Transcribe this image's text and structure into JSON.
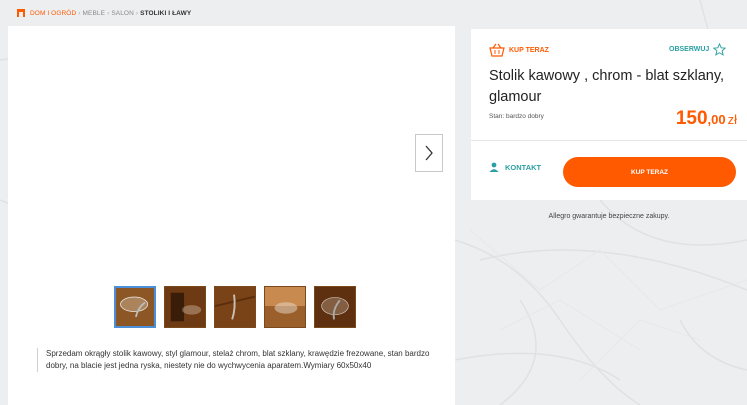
{
  "breadcrumb": {
    "items": [
      "DOM I OGRÓD",
      "MEBLE",
      "SALON",
      "STOLIKI I ŁAWY"
    ],
    "separator": "›"
  },
  "gallery": {
    "main_photo_icon": "glass-table-photo",
    "next_arrow_icon": "chevron-right-icon",
    "thumbnail_count": 5,
    "active_thumbnail": 1
  },
  "offer": {
    "badge_label": "KUP TERAZ",
    "watch_label": "OBSERWUJ",
    "title": "Stolik kawowy , chrom - blat szklany, glamour",
    "condition": "Stan: bardzo dobry",
    "price_integer": "150",
    "price_decimal": ",00",
    "price_currency": "zł",
    "contact_label": "KONTAKT",
    "buy_button_label": "KUP TERAZ",
    "guarantee_text": "Allegro gwarantuje bezpieczne zakupy."
  },
  "description": {
    "text": "Sprzedam okrągły stolik kawowy, styl glamour, stelaż chrom, blat szklany, krawędzie frezowane, stan bardzo dobry, na blacie jest jedna ryska, niestety nie do wychwycenia aparatem.Wymiary 60x50x40"
  },
  "colors": {
    "accent": "#ff5a00",
    "link": "#2ba0a3",
    "thumb_active_border": "#4a8fd8"
  }
}
